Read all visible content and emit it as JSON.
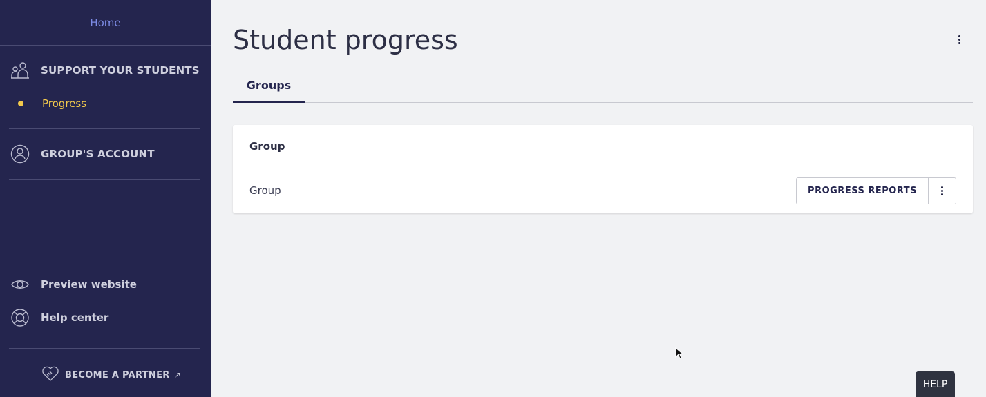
{
  "sidebar": {
    "home_label": "Home",
    "support_label": "SUPPORT YOUR STUDENTS",
    "progress_label": "Progress",
    "account_label": "GROUP'S ACCOUNT",
    "preview_label": "Preview website",
    "help_center_label": "Help center",
    "partner_label": "BECOME A PARTNER",
    "partner_arrow": "↗",
    "active_color": "#f2c94c"
  },
  "main": {
    "title": "Student progress",
    "tabs": [
      {
        "label": "Groups"
      }
    ],
    "table": {
      "header": "Group",
      "rows": [
        {
          "name": "Group",
          "action_label": "PROGRESS REPORTS"
        }
      ]
    },
    "help_label": "HELP"
  },
  "icons": {
    "students": "students-icon",
    "account": "user-circle-icon",
    "preview": "eye-icon",
    "help": "lifebuoy-icon",
    "partner": "heart-handshake-icon",
    "more": "kebab-icon"
  }
}
